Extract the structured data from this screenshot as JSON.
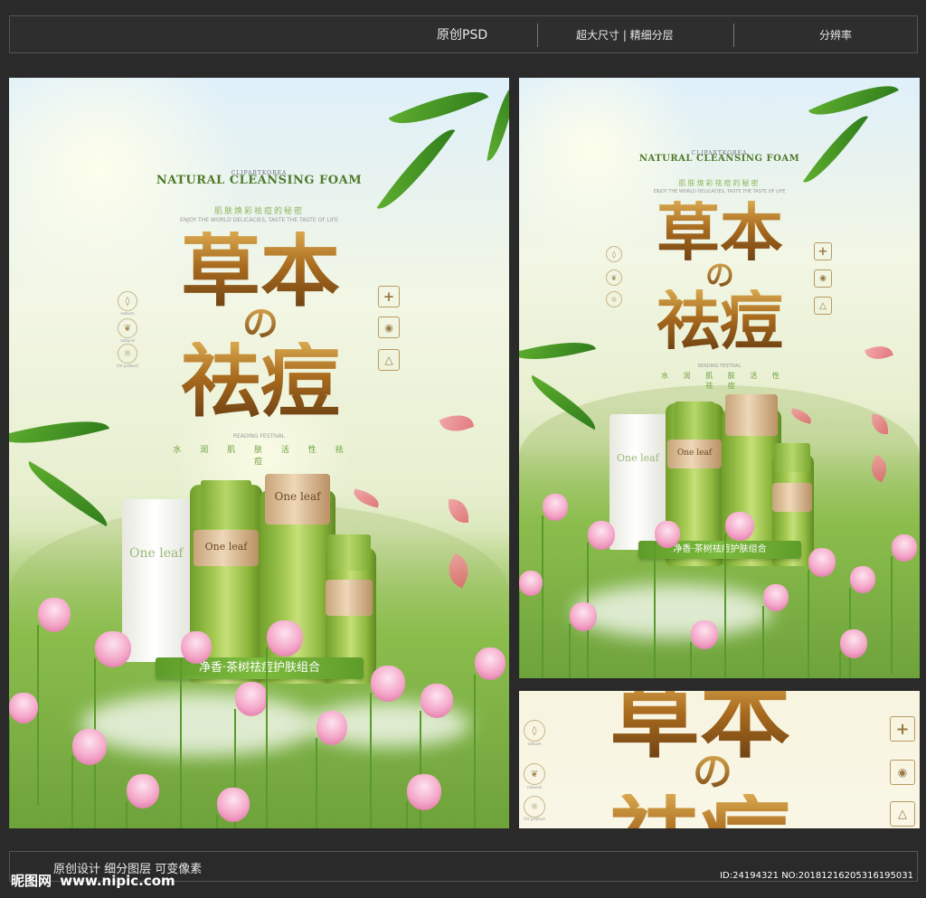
{
  "header": {
    "item1": "原创PSD",
    "item2": "超大尺寸 | 精细分层",
    "item3": "分辨率"
  },
  "poster": {
    "eyebrow": "CLIPARTKOREA",
    "title_en": "NATURAL CLEANSING FOAM",
    "subtitle_cn": "肌肤焕彩祛痘的秘密",
    "subtitle_en": "ENJOY THE WORLD DELICACIES, TASTE THE TASTE OF LIFE",
    "big_line1": "草本",
    "big_mid": "の",
    "big_line2": "祛痘",
    "festival": "READING FESTIVAL",
    "features_cn": "水 润 肌 肤 活 性 祛 痘",
    "product_label": "One leaf",
    "banner": "净香·茶树祛痘护肤组合",
    "side_icons": [
      {
        "label": "sebum",
        "icon": "droplet-icon"
      },
      {
        "label": "natural",
        "icon": "leaf-icon"
      },
      {
        "label": "UV protect",
        "icon": "sun-icon"
      }
    ],
    "right_icons": [
      {
        "icon": "plus-icon",
        "glyph": "+"
      },
      {
        "icon": "drop-circle-icon",
        "glyph": "◉"
      },
      {
        "icon": "triangle-nodes-icon",
        "glyph": "△"
      }
    ]
  },
  "footer": {
    "caption": "原创设计 细分图层 可变像素",
    "watermark_cn": "昵图网",
    "watermark_site": "www.nipic.com",
    "id_text": "ID:24194321 NO:20181216205316195031"
  },
  "colors": {
    "background": "#2a2a2a",
    "gold": "#a86a1e",
    "green": "#6ea03e"
  }
}
